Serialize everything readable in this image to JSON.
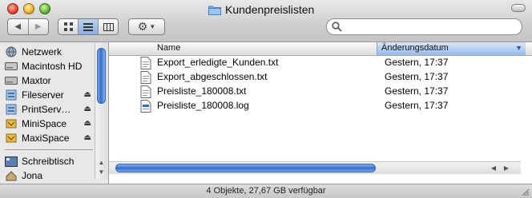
{
  "window": {
    "title": "Kundenpreislisten"
  },
  "toolbar": {
    "back_icon": "back-arrow-icon",
    "forward_icon": "forward-arrow-icon",
    "views": [
      "icon-view-icon",
      "list-view-icon",
      "column-view-icon"
    ],
    "selected_view": "list-view-icon",
    "action_icon": "gear-icon",
    "search": {
      "value": "",
      "placeholder": ""
    }
  },
  "sidebar": {
    "items": [
      {
        "label": "Netzwerk",
        "icon": "network-globe-icon",
        "eject": false
      },
      {
        "label": "Macintosh HD",
        "icon": "hard-drive-icon",
        "eject": false
      },
      {
        "label": "Maxtor",
        "icon": "hard-drive-icon",
        "eject": false
      },
      {
        "label": "Fileserver",
        "icon": "server-icon",
        "eject": true
      },
      {
        "label": "PrintServ…",
        "icon": "server-icon",
        "eject": true
      },
      {
        "label": "MiniSpace",
        "icon": "network-volume-icon",
        "eject": true
      },
      {
        "label": "MaxiSpace",
        "icon": "network-volume-icon",
        "eject": true
      }
    ],
    "places": [
      {
        "label": "Schreibtisch",
        "icon": "desktop-icon"
      },
      {
        "label": "Jona",
        "icon": "home-icon"
      }
    ]
  },
  "list": {
    "columns": {
      "name": "Name",
      "date": "Änderungsdatum"
    },
    "sort_column": "date",
    "rows": [
      {
        "name": "Export_erledigte_Kunden.txt",
        "date": "Gestern, 17:37",
        "icon": "text-document-icon"
      },
      {
        "name": "Export_abgeschlossen.txt",
        "date": "Gestern, 17:37",
        "icon": "text-document-icon"
      },
      {
        "name": "Preisliste_180008.txt",
        "date": "Gestern, 17:37",
        "icon": "text-document-icon"
      },
      {
        "name": "Preisliste_180008.log",
        "date": "Gestern, 17:37",
        "icon": "log-document-icon"
      }
    ]
  },
  "status": {
    "text": "4 Objekte, 27,67 GB verfügbar"
  },
  "colors": {
    "accent": "#3a78d4",
    "sort_header": "#a9c4ec"
  }
}
